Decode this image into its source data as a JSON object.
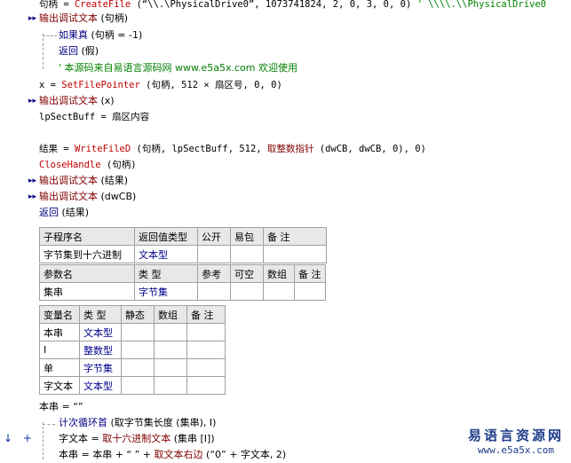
{
  "lines": {
    "l0": {
      "a": "句柄 = ",
      "b": "CreateFile",
      "c": " (“\\\\.\\PhysicalDrive0”, 1073741824, 2, 0, 3, 0, 0)  ",
      "d": "' \\\\\\\\.\\\\PhysicalDrive0"
    },
    "l1": {
      "a": "输出调试文本",
      "b": " (句柄)"
    },
    "l2": {
      "a": "如果真",
      "b": " (句柄 = -1)"
    },
    "l3": {
      "a": "返回",
      "b": " (假)"
    },
    "l4": {
      "a": "' 本源码来自易语言源码网 www.e5a5x.com  欢迎使用"
    },
    "l5": {
      "a": "x = ",
      "b": "SetFilePointer",
      "c": " (句柄, 512 × 扇区号, 0, 0)"
    },
    "l6": {
      "a": "输出调试文本",
      "b": " (x)"
    },
    "l7": {
      "a": "lpSectBuff = 扇区内容"
    },
    "l8": {
      "a": "结果 = ",
      "b": "WriteFileD",
      "c": " (句柄, lpSectBuff, 512, ",
      "d": "取整数指针",
      "e": " (dwCB, dwCB, 0), 0)"
    },
    "l9": {
      "a": "CloseHandle",
      "b": " (句柄)"
    },
    "l10": {
      "a": "输出调试文本",
      "b": " (结果)"
    },
    "l11": {
      "a": "输出调试文本",
      "b": " (dwCB)"
    },
    "l12": {
      "a": "返回",
      "b": " (结果)"
    },
    "l13": {
      "a": "本串 = “”"
    },
    "l14": {
      "a": "计次循环首",
      "b": " (取字节集长度 (集串), I)"
    },
    "l15": {
      "a": "字文本 = ",
      "b": "取十六进制文本",
      "c": " (集串 [I])"
    },
    "l16": {
      "a": "本串 = 本串 + “ ” + ",
      "b": "取文本右边",
      "c": " (“0” + 字文本, 2)"
    }
  },
  "sub_table": {
    "header1": [
      "子程序名",
      "返回值类型",
      "公开",
      "易包",
      "备 注"
    ],
    "row1": [
      "字节集到十六进制",
      "文本型",
      "",
      "",
      ""
    ],
    "header2": [
      "参数名",
      "类 型",
      "参考",
      "可空",
      "数组",
      "备 注"
    ],
    "row2": [
      "集串",
      "字节集",
      "",
      "",
      "",
      ""
    ]
  },
  "var_table": {
    "header": [
      "变量名",
      "类 型",
      "静态",
      "数组",
      "备 注"
    ],
    "rows": [
      [
        "本串",
        "文本型",
        "",
        "",
        ""
      ],
      [
        "I",
        "整数型",
        "",
        "",
        ""
      ],
      [
        "单",
        "字节集",
        "",
        "",
        ""
      ],
      [
        "字文本",
        "文本型",
        "",
        "",
        ""
      ]
    ]
  },
  "markers": {
    "arrow": "▸▸",
    "down_arrow": "↓",
    "plus": "+"
  },
  "watermark": {
    "title": "易语言资源网",
    "url": "www.e5a5x.com"
  },
  "colors": {
    "keyword": "#800000",
    "api": "#c00000",
    "comment": "#008000",
    "type": "#00008b"
  }
}
